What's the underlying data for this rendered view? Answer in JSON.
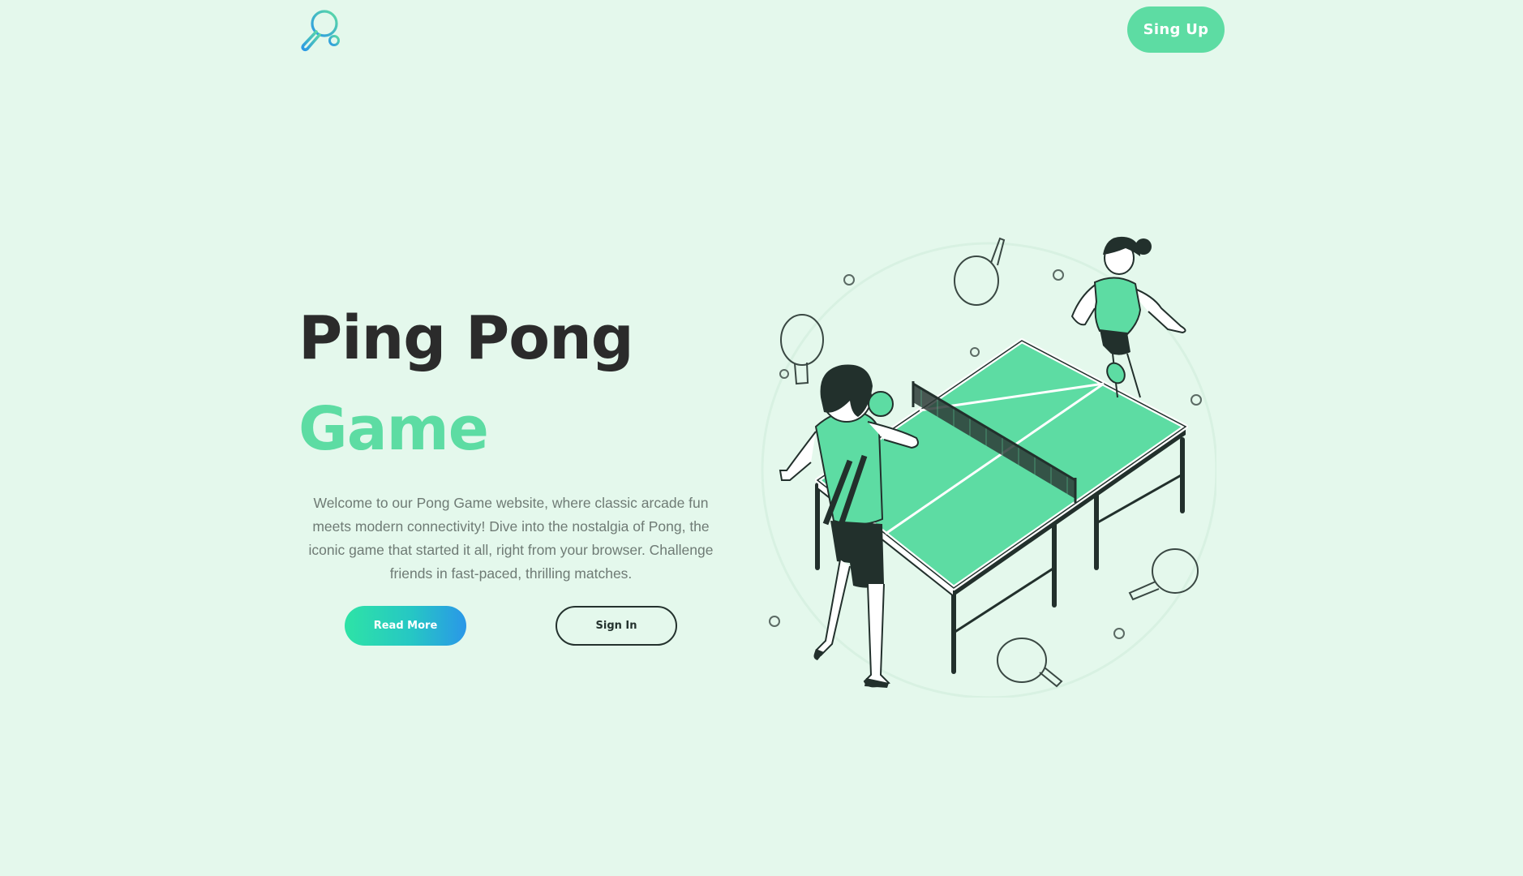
{
  "header": {
    "logo_icon": "ping-pong-paddle-icon",
    "signup_label": "Sing Up"
  },
  "hero": {
    "title_line1": "Ping Pong",
    "title_line2": "Game",
    "description": "Welcome to our Pong Game website, where classic arcade fun meets modern connectivity! Dive into the nostalgia of Pong, the iconic game that started it all, right from your browser. Challenge friends in fast-paced, thrilling matches.",
    "read_more_label": "Read More",
    "sign_in_label": "Sign In"
  },
  "illustration": {
    "icon": "ping-pong-players-illustration"
  },
  "colors": {
    "background": "#e4f8ec",
    "accent": "#5ddca3",
    "title_dark": "#2b2b2b",
    "text_muted": "#6f7b75",
    "gradient_start": "#2ee3a6",
    "gradient_end": "#2a97e8"
  }
}
